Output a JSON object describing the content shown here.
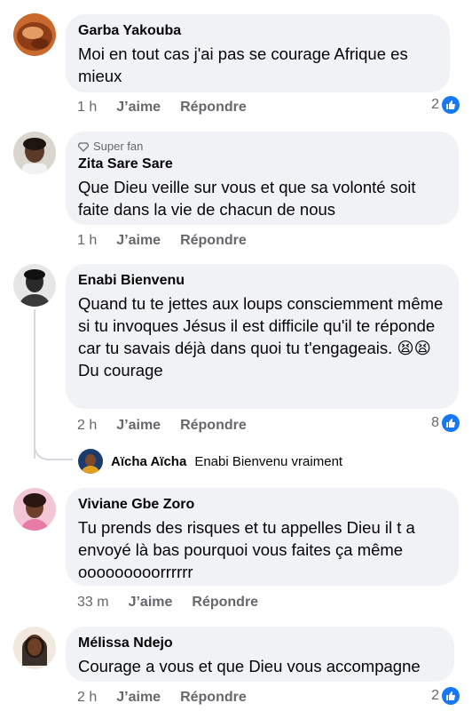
{
  "comments": [
    {
      "author": "Garba Yakouba",
      "text": "Moi en tout cas j'ai pas se courage Afrique es mieux",
      "time": "1 h",
      "like": "J’aime",
      "reply": "Répondre",
      "reactions": "2"
    },
    {
      "badge": "Super fan",
      "author": "Zita Sare Sare",
      "text": "Que Dieu veille sur vous et que sa volonté soit faite dans la vie de chacun de nous",
      "time": "1 h",
      "like": "J’aime",
      "reply": "Répondre"
    },
    {
      "author": "Enabi Bienvenu",
      "text": "Quand tu te jettes aux loups consciemment même si tu invoques Jésus il est difficile qu'il te réponde car tu savais déjà dans quoi tu t'engageais. 😫😫",
      "text2": "Du courage",
      "time": "2 h",
      "like": "J’aime",
      "reply": "Répondre",
      "reactions": "8"
    },
    {
      "author": "Viviane Gbe Zoro",
      "text": "Tu prends des risques et tu appelles Dieu il t a envoyé là bas  pourquoi vous faites ça même ooooooooorrrrrr",
      "time": "33 m",
      "like": "J’aime",
      "reply": "Répondre"
    },
    {
      "author": "Mélissa Ndejo",
      "text": "Courage a vous et que Dieu vous accompagne",
      "time": "2 h",
      "like": "J’aime",
      "reply": "Répondre",
      "reactions": "2"
    }
  ],
  "reply_preview": {
    "author": "Aïcha Aïcha",
    "text": "Enabi Bienvenu vraiment"
  },
  "colors": {
    "bubble": "#f0f2f5",
    "secondary_text": "#65676b",
    "like_blue": "#1877f2"
  }
}
